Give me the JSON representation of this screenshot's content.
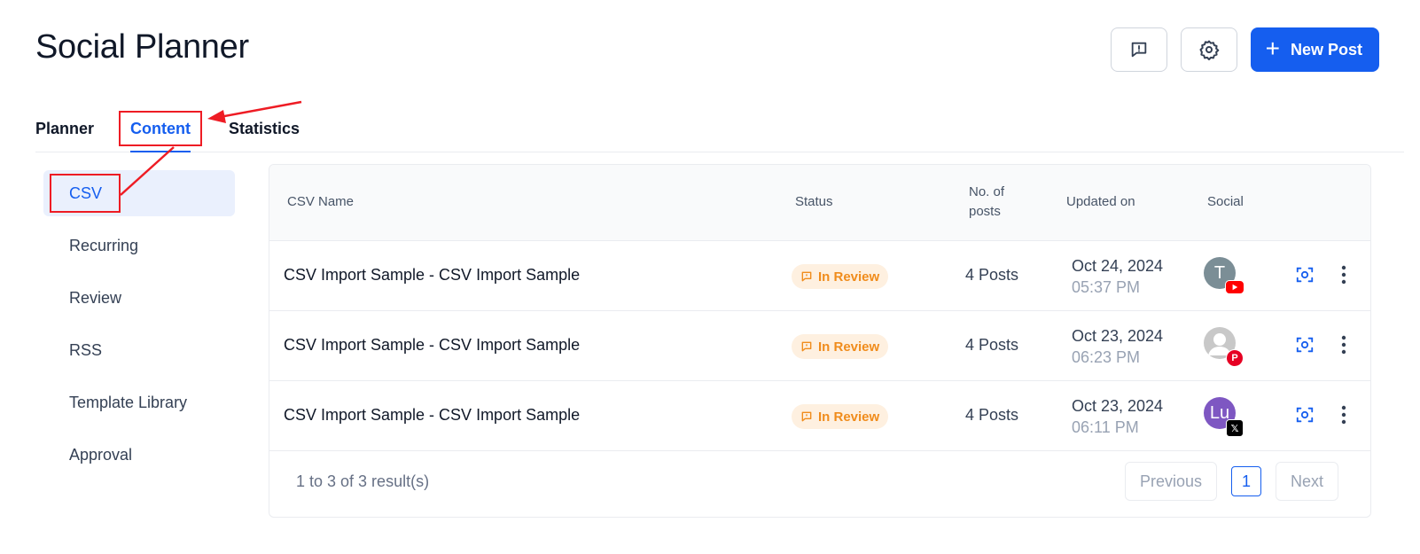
{
  "header": {
    "title": "Social Planner",
    "feedback_icon": "message-alert-icon",
    "settings_icon": "gear-icon",
    "new_post_label": "New Post"
  },
  "tabs": [
    {
      "label": "Planner",
      "active": false
    },
    {
      "label": "Content",
      "active": true
    },
    {
      "label": "Statistics",
      "active": false
    }
  ],
  "side_nav": [
    {
      "label": "CSV",
      "active": true
    },
    {
      "label": "Recurring",
      "active": false
    },
    {
      "label": "Review",
      "active": false
    },
    {
      "label": "RSS",
      "active": false
    },
    {
      "label": "Template Library",
      "active": false
    },
    {
      "label": "Approval",
      "active": false
    }
  ],
  "table": {
    "columns": {
      "name": "CSV Name",
      "status": "Status",
      "posts_line1": "No. of",
      "posts_line2": "posts",
      "updated": "Updated on",
      "social": "Social"
    },
    "rows": [
      {
        "name": "CSV Import Sample - CSV Import Sample",
        "status": "In Review",
        "posts": "4 Posts",
        "date": "Oct 24, 2024",
        "time": "05:37 PM",
        "avatar": "T",
        "avatar_color": "#7b8e96",
        "social": "youtube-icon",
        "social_color": "#ff0000"
      },
      {
        "name": "CSV Import Sample - CSV Import Sample",
        "status": "In Review",
        "posts": "4 Posts",
        "date": "Oct 23, 2024",
        "time": "06:23 PM",
        "avatar": "",
        "avatar_color": "#c8c8c8",
        "social": "pinterest-icon",
        "social_color": "#e60023"
      },
      {
        "name": "CSV Import Sample - CSV Import Sample",
        "status": "In Review",
        "posts": "4 Posts",
        "date": "Oct 23, 2024",
        "time": "06:11 PM",
        "avatar": "Lu",
        "avatar_color": "#7e57c2",
        "social": "x-icon",
        "social_color": "#000000"
      }
    ],
    "footer": {
      "results": "1 to 3 of 3 result(s)",
      "previous": "Previous",
      "page": "1",
      "next": "Next"
    }
  },
  "colors": {
    "accent": "#155eef",
    "status_review_text": "#f08c1c",
    "status_review_bg": "#fef0e0",
    "annotation": "#ee1c24"
  }
}
